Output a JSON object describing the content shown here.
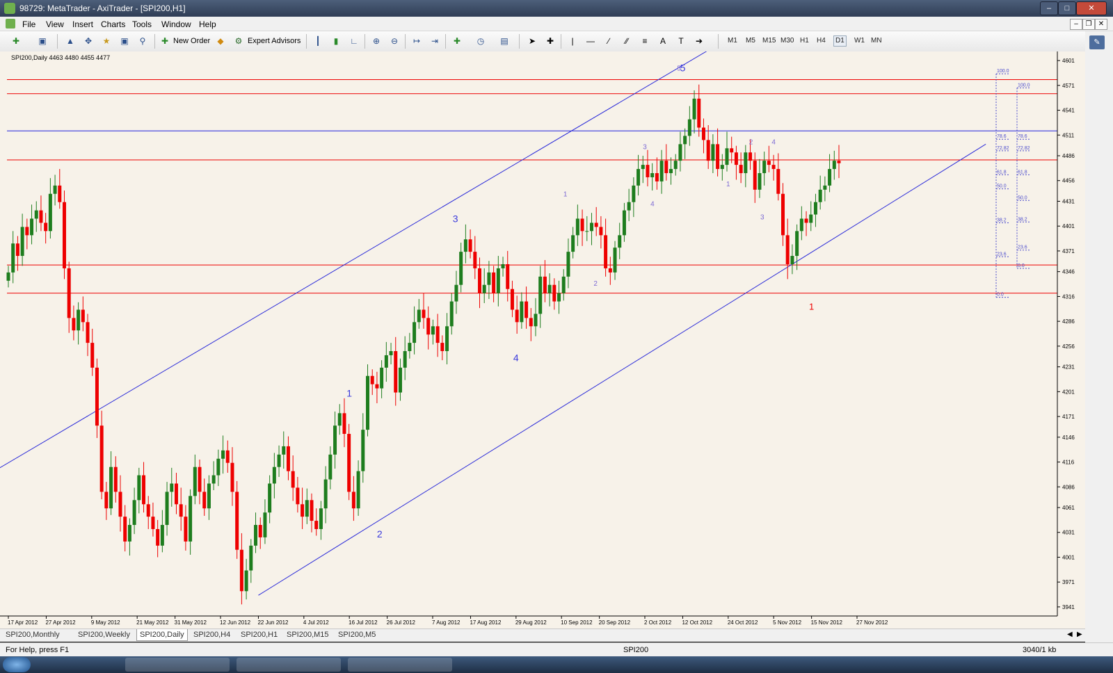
{
  "window": {
    "title": "98729: MetaTrader - AxiTrader - [SPI200,H1]"
  },
  "menu": [
    "File",
    "View",
    "Insert",
    "Charts",
    "Tools",
    "Window",
    "Help"
  ],
  "toolbar": {
    "new_order": "New Order",
    "expert_advisors": "Expert Advisors",
    "timeframes": [
      "M1",
      "M5",
      "M15",
      "M30",
      "H1",
      "H4",
      "D1",
      "W1",
      "MN"
    ],
    "active_timeframe": "D1"
  },
  "chart_info": "SPI200,Daily  4463 4480 4455 4477",
  "tabs": [
    "SPI200,Monthly",
    "SPI200,Weekly",
    "SPI200,Daily",
    "SPI200,H4",
    "SPI200,H1",
    "SPI200,M15",
    "SPI200,M5"
  ],
  "active_tab": "SPI200,Daily",
  "status": {
    "help": "For Help, press F1",
    "symbol": "SPI200",
    "traffic": "3040/1 kb"
  },
  "colors": {
    "background": "#f7f2e9",
    "bull": "#1e7d1e",
    "bear": "#ee0000",
    "hline_red": "#ee0000",
    "hline_blue": "#2020dd",
    "channel": "#2b2bd9",
    "wave": "#3a3adc",
    "wave_small": "#7c6ad4",
    "fib": "#4a4acc"
  },
  "chart_data": {
    "type": "candlestick",
    "symbol": "SPI200",
    "timeframe": "Daily",
    "ylim": [
      3930,
      4612
    ],
    "price_ticks": [
      4601,
      4571,
      4541,
      4511,
      4486,
      4456,
      4431,
      4401,
      4371,
      4346,
      4316,
      4286,
      4256,
      4231,
      4201,
      4171,
      4146,
      4116,
      4086,
      4061,
      4031,
      4001,
      3971,
      3941
    ],
    "date_ticks": [
      "17 Apr 2012",
      "27 Apr 2012",
      "9 May 2012",
      "21 May 2012",
      "31 May 2012",
      "12 Jun 2012",
      "22 Jun 2012",
      "4 Jul 2012",
      "16 Jul 2012",
      "26 Jul 2012",
      "7 Aug 2012",
      "17 Aug 2012",
      "29 Aug 2012",
      "10 Sep 2012",
      "20 Sep 2012",
      "2 Oct 2012",
      "12 Oct 2012",
      "24 Oct 2012",
      "5 Nov 2012",
      "15 Nov 2012",
      "27 Nov 2012"
    ],
    "closes": [
      4345,
      4380,
      4365,
      4400,
      4390,
      4410,
      4420,
      4405,
      4395,
      4440,
      4450,
      4430,
      4350,
      4290,
      4275,
      4300,
      4285,
      4260,
      4230,
      4160,
      4080,
      4060,
      4110,
      4080,
      4050,
      4020,
      4040,
      4070,
      4100,
      4065,
      4050,
      4035,
      4015,
      4040,
      4080,
      4090,
      4065,
      4050,
      4020,
      4075,
      4110,
      4080,
      4060,
      4090,
      4100,
      4120,
      4130,
      4115,
      4080,
      4010,
      3960,
      3985,
      4015,
      4040,
      4025,
      4055,
      4090,
      4110,
      4125,
      4135,
      4105,
      4085,
      4065,
      4050,
      4070,
      4045,
      4035,
      4060,
      4095,
      4125,
      4160,
      4175,
      4150,
      4080,
      4060,
      4105,
      4155,
      4220,
      4210,
      4205,
      4230,
      4245,
      4250,
      4200,
      4230,
      4250,
      4260,
      4285,
      4300,
      4290,
      4270,
      4280,
      4260,
      4250,
      4280,
      4310,
      4330,
      4370,
      4385,
      4370,
      4350,
      4320,
      4330,
      4345,
      4320,
      4350,
      4355,
      4325,
      4300,
      4285,
      4310,
      4290,
      4280,
      4295,
      4340,
      4320,
      4330,
      4310,
      4320,
      4340,
      4370,
      4390,
      4410,
      4395,
      4395,
      4405,
      4400,
      4390,
      4350,
      4345,
      4375,
      4390,
      4420,
      4430,
      4450,
      4470,
      4475,
      4460,
      4465,
      4455,
      4480,
      4465,
      4470,
      4480,
      4500,
      4510,
      4530,
      4555,
      4520,
      4505,
      4480,
      4500,
      4470,
      4475,
      4495,
      4490,
      4475,
      4465,
      4490,
      4480,
      4445,
      4465,
      4480,
      4475,
      4470,
      4440,
      4390,
      4355,
      4365,
      4395,
      4410,
      4405,
      4415,
      4430,
      4445,
      4450,
      4470,
      4480,
      4477
    ],
    "horizontal_levels": [
      {
        "price": 4578,
        "label": "4578",
        "color": "#ee0000"
      },
      {
        "price": 4561,
        "label": "4561",
        "color": "#ee0000"
      },
      {
        "price": 4516,
        "label": "4516",
        "color": "#2020dd"
      },
      {
        "price": 4481,
        "label": "4481",
        "color": "#ee0000"
      },
      {
        "price": 4354,
        "label": "4354",
        "color": "#ee0000"
      },
      {
        "price": 4320,
        "label": "4320",
        "color": "#ee0000"
      }
    ],
    "current_price": {
      "label": "4477"
    },
    "channel_lines": [
      {
        "from": [
          "4 Apr 2012",
          4080
        ],
        "to": [
          "5 Nov 2012",
          4660
        ]
      },
      {
        "from": [
          "22 Jun 2012",
          3955
        ],
        "to": [
          "31 Dec 2012",
          4500
        ]
      }
    ],
    "wave_labels": [
      {
        "text": "1",
        "date": "16 Jul 2012",
        "price": 4195,
        "size": "large",
        "color": "#3a3adc"
      },
      {
        "text": "2",
        "date": "24 Jul 2012",
        "price": 4025,
        "size": "large",
        "color": "#3a3adc"
      },
      {
        "text": "3",
        "date": "13 Aug 2012",
        "price": 4406,
        "size": "large",
        "color": "#3a3adc"
      },
      {
        "text": "4",
        "date": "29 Aug 2012",
        "price": 4238,
        "size": "large",
        "color": "#3a3adc"
      },
      {
        "text": "5",
        "date": "12 Oct 2012",
        "price": 4588,
        "size": "large",
        "color": "#3a3adc"
      },
      {
        "text": "1",
        "date": "11 Sep 2012",
        "price": 4437,
        "size": "small",
        "color": "#7c6ad4"
      },
      {
        "text": "2",
        "date": "19 Sep 2012",
        "price": 4329,
        "size": "small",
        "color": "#7c6ad4"
      },
      {
        "text": "3",
        "date": "2 Oct 2012",
        "price": 4494,
        "size": "small",
        "color": "#7c6ad4"
      },
      {
        "text": "4",
        "date": "4 Oct 2012",
        "price": 4425,
        "size": "small",
        "color": "#7c6ad4"
      },
      {
        "text": "5",
        "date": "11 Oct 2012",
        "price": 4589,
        "size": "small",
        "color": "#7c6ad4"
      },
      {
        "text": "1",
        "date": "24 Oct 2012",
        "price": 4449,
        "size": "small",
        "color": "#7c6ad4"
      },
      {
        "text": "2",
        "date": "30 Oct 2012",
        "price": 4500,
        "size": "small",
        "color": "#7c6ad4"
      },
      {
        "text": "3",
        "date": "2 Nov 2012",
        "price": 4409,
        "size": "small",
        "color": "#7c6ad4"
      },
      {
        "text": "4",
        "date": "5 Nov 2012",
        "price": 4500,
        "size": "small",
        "color": "#7c6ad4"
      },
      {
        "text": "1",
        "date": "15 Nov 2012",
        "price": 4300,
        "size": "medium",
        "color": "#ee0000"
      }
    ],
    "fib_a": [
      {
        "label": "100.0",
        "price": 4585
      },
      {
        "label": "78.6",
        "price": 4506
      },
      {
        "label": "72.82",
        "price": 4492
      },
      {
        "label": "61.8",
        "price": 4463
      },
      {
        "label": "50.0",
        "price": 4446
      },
      {
        "label": "38.2",
        "price": 4405
      },
      {
        "label": "23.6",
        "price": 4364
      },
      {
        "label": "0.0",
        "price": 4315
      }
    ],
    "fib_b": [
      {
        "label": "100.0",
        "price": 4568
      },
      {
        "label": "78.6",
        "price": 4506
      },
      {
        "label": "72.82",
        "price": 4492
      },
      {
        "label": "61.8",
        "price": 4463
      },
      {
        "label": "50.0",
        "price": 4432
      },
      {
        "label": "38.2",
        "price": 4406
      },
      {
        "label": "23.6",
        "price": 4372
      },
      {
        "label": "0.0",
        "price": 4350
      }
    ]
  }
}
